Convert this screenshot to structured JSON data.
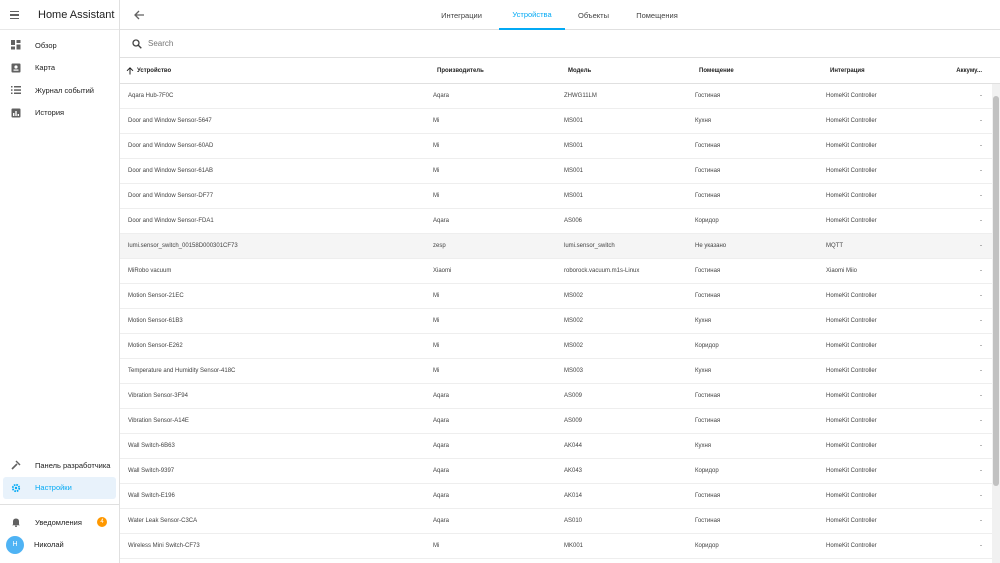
{
  "app": {
    "title": "Home Assistant"
  },
  "sidebar": {
    "items": [
      {
        "label": "Обзор",
        "icon": "dashboard-icon"
      },
      {
        "label": "Карта",
        "icon": "map-icon"
      },
      {
        "label": "Журнал событий",
        "icon": "logbook-icon"
      },
      {
        "label": "История",
        "icon": "history-icon"
      }
    ],
    "developer": {
      "label": "Панель разработчика",
      "icon": "hammer-icon"
    },
    "settings": {
      "label": "Настройки",
      "icon": "gear-icon"
    },
    "notifications": {
      "label": "Уведомления",
      "icon": "bell-icon",
      "count": "4"
    },
    "user": {
      "label": "Николай",
      "initial": "Н"
    }
  },
  "tabs": [
    {
      "label": "Интеграции"
    },
    {
      "label": "Устройства",
      "active": true
    },
    {
      "label": "Объекты"
    },
    {
      "label": "Помещения"
    }
  ],
  "search": {
    "placeholder": "Search"
  },
  "table": {
    "headers": [
      "Устройство",
      "Производитель",
      "Модель",
      "Помещение",
      "Интеграция",
      "Аккуму..."
    ],
    "rows": [
      [
        "Aqara Hub-7F0C",
        "Aqara",
        "ZHWG11LM",
        "Гостиная",
        "HomeKit Controller",
        "-"
      ],
      [
        "Door and Window Sensor-5647",
        "Mi",
        "MS001",
        "Кухня",
        "HomeKit Controller",
        "-"
      ],
      [
        "Door and Window Sensor-60AD",
        "Mi",
        "MS001",
        "Гостиная",
        "HomeKit Controller",
        "-"
      ],
      [
        "Door and Window Sensor-61AB",
        "Mi",
        "MS001",
        "Гостиная",
        "HomeKit Controller",
        "-"
      ],
      [
        "Door and Window Sensor-DF77",
        "Mi",
        "MS001",
        "Гостиная",
        "HomeKit Controller",
        "-"
      ],
      [
        "Door and Window Sensor-FDA1",
        "Aqara",
        "AS006",
        "Коридор",
        "HomeKit Controller",
        "-"
      ],
      [
        "lumi.sensor_switch_00158D000301CF73",
        "zesp",
        "lumi.sensor_switch",
        "Не указано",
        "MQTT",
        "-"
      ],
      [
        "MiRobo vacuum",
        "Xiaomi",
        "roborock.vacuum.m1s-Linux",
        "Гостиная",
        "Xiaomi Miio",
        "-"
      ],
      [
        "Motion Sensor-21EC",
        "Mi",
        "MS002",
        "Гостиная",
        "HomeKit Controller",
        "-"
      ],
      [
        "Motion Sensor-61B3",
        "Mi",
        "MS002",
        "Кухня",
        "HomeKit Controller",
        "-"
      ],
      [
        "Motion Sensor-E262",
        "Mi",
        "MS002",
        "Коридор",
        "HomeKit Controller",
        "-"
      ],
      [
        "Temperature and Humidity Sensor-418C",
        "Mi",
        "MS003",
        "Кухня",
        "HomeKit Controller",
        "-"
      ],
      [
        "Vibration Sensor-3F94",
        "Aqara",
        "AS009",
        "Гостиная",
        "HomeKit Controller",
        "-"
      ],
      [
        "Vibration Sensor-A14E",
        "Aqara",
        "AS009",
        "Гостиная",
        "HomeKit Controller",
        "-"
      ],
      [
        "Wall Switch-6B63",
        "Aqara",
        "AK044",
        "Кухня",
        "HomeKit Controller",
        "-"
      ],
      [
        "Wall Switch-9397",
        "Aqara",
        "AK043",
        "Коридор",
        "HomeKit Controller",
        "-"
      ],
      [
        "Wall Switch-E196",
        "Aqara",
        "AK014",
        "Гостиная",
        "HomeKit Controller",
        "-"
      ],
      [
        "Water Leak Sensor-C3CA",
        "Aqara",
        "AS010",
        "Гостиная",
        "HomeKit Controller",
        "-"
      ],
      [
        "Wireless Mini Switch-CF73",
        "Mi",
        "MK001",
        "Коридор",
        "HomeKit Controller",
        "-"
      ]
    ],
    "highlighted_row": 6
  },
  "colors": {
    "accent": "#03a9f4",
    "badge": "#ff9800",
    "avatar": "#4fb3f4"
  }
}
